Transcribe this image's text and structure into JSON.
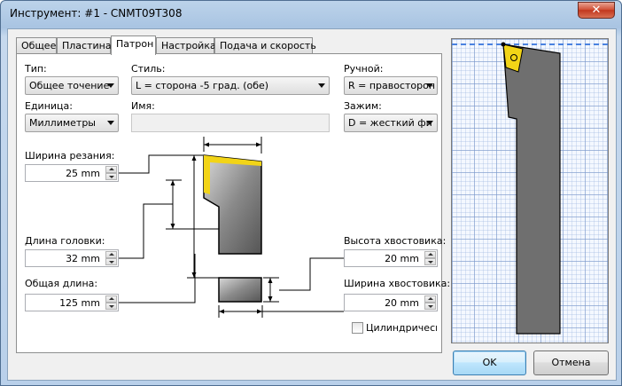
{
  "window": {
    "title": "Инструмент: #1 - CNMT09T308",
    "close_label": "✕"
  },
  "tabs": [
    {
      "label": "Общее",
      "active": false
    },
    {
      "label": "Пластина",
      "active": false
    },
    {
      "label": "Патрон",
      "active": true
    },
    {
      "label": "Настройка",
      "active": false
    },
    {
      "label": "Подача и скорость",
      "active": false
    }
  ],
  "fields": {
    "type": {
      "label": "Тип:",
      "value": "Общее точение"
    },
    "style": {
      "label": "Стиль:",
      "value": "L = сторона -5 град. (обе)"
    },
    "hand": {
      "label": "Ручной:",
      "value": "R = правосторон"
    },
    "units": {
      "label": "Единица:",
      "value": "Миллиметры"
    },
    "name": {
      "label": "Имя:",
      "value": ""
    },
    "clamp": {
      "label": "Зажим:",
      "value": "D = жесткий фи"
    },
    "cutting_width": {
      "label": "Ширина резания:",
      "value": "25 mm"
    },
    "head_length": {
      "label": "Длина головки:",
      "value": "32 mm"
    },
    "overall_length": {
      "label": "Общая длина:",
      "value": "125 mm"
    },
    "shank_height": {
      "label": "Высота хвостовика:",
      "value": "20 mm"
    },
    "shank_width": {
      "label": "Ширина хвостовика:",
      "value": "20 mm"
    },
    "cylindrical": {
      "label": "Цилиндрическ",
      "checked": false
    }
  },
  "buttons": {
    "ok": "OK",
    "cancel": "Отмена"
  },
  "colors": {
    "insert": "#f2d417",
    "tool_body": "#6f6f6f",
    "guide_line": "#4a82e0"
  }
}
